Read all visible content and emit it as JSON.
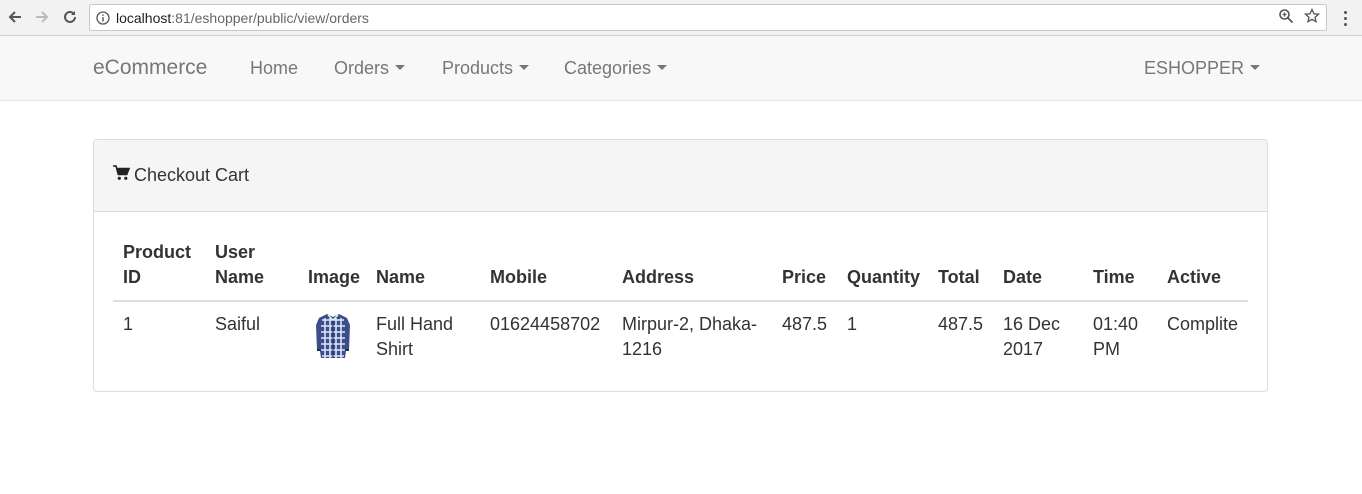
{
  "browser": {
    "url_host": "localhost",
    "url_rest": ":81/eshopper/public/view/orders"
  },
  "navbar": {
    "brand": "eCommerce",
    "items": [
      {
        "label": "Home"
      },
      {
        "label": "Orders"
      },
      {
        "label": "Products"
      },
      {
        "label": "Categories"
      }
    ],
    "user_menu": "ESHOPPER"
  },
  "panel": {
    "title": "Checkout Cart",
    "icon": "shopping-cart-icon"
  },
  "table": {
    "headers": {
      "product_id_1": "Product",
      "product_id_2": "ID",
      "user_name_1": "User",
      "user_name_2": "Name",
      "image": "Image",
      "name": "Name",
      "mobile": "Mobile",
      "address": "Address",
      "price": "Price",
      "quantity": "Quantity",
      "total": "Total",
      "date": "Date",
      "time": "Time",
      "active": "Active"
    },
    "rows": [
      {
        "product_id": "1",
        "user_name": "Saiful",
        "name_1": "Full Hand",
        "name_2": "Shirt",
        "mobile": "01624458702",
        "address_1": "Mirpur-2, Dhaka-",
        "address_2": "1216",
        "price": "487.5",
        "quantity": "1",
        "total": "487.5",
        "date_1": "16 Dec",
        "date_2": "2017",
        "time_1": "01:40",
        "time_2": "PM",
        "active": "Complite"
      }
    ]
  }
}
